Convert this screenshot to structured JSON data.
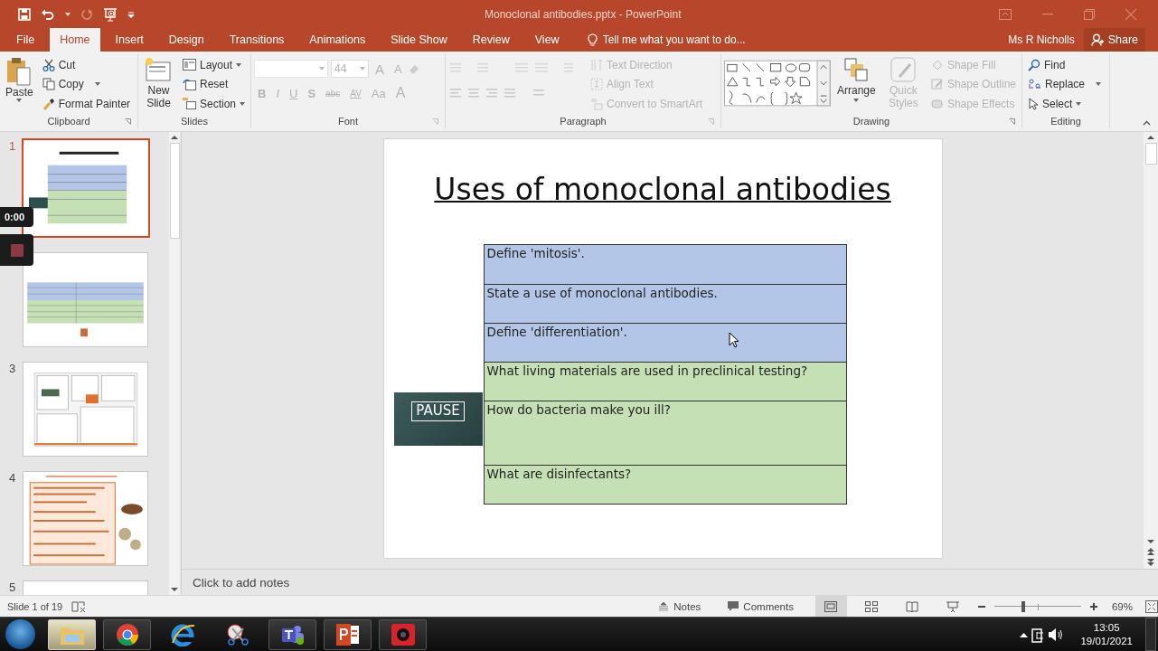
{
  "window": {
    "title": "Monoclonal antibodies.pptx - PowerPoint"
  },
  "tabs": [
    {
      "label": "File",
      "selected": false
    },
    {
      "label": "Home",
      "selected": true
    },
    {
      "label": "Insert",
      "selected": false
    },
    {
      "label": "Design",
      "selected": false
    },
    {
      "label": "Transitions",
      "selected": false
    },
    {
      "label": "Animations",
      "selected": false
    },
    {
      "label": "Slide Show",
      "selected": false
    },
    {
      "label": "Review",
      "selected": false
    },
    {
      "label": "View",
      "selected": false
    }
  ],
  "tell_me": {
    "placeholder": "Tell me what you want to do..."
  },
  "user": "Ms R Nicholls",
  "share": "Share",
  "clipboard": {
    "paste": "Paste",
    "cut": "Cut",
    "copy": "Copy",
    "format_painter": "Format Painter",
    "label": "Clipboard"
  },
  "slides_group": {
    "new_slide": "New Slide",
    "layout": "Layout",
    "reset": "Reset",
    "section": "Section",
    "label": "Slides"
  },
  "font": {
    "disabled": true,
    "size": "44",
    "size_buttons": [
      "A",
      "A"
    ],
    "format_buttons": [
      "B",
      "I",
      "U",
      "S",
      "abc",
      "AV",
      "Aa"
    ],
    "color_button": "A",
    "label": "Font"
  },
  "paragraph": {
    "disabled": true,
    "text_direction": "Text Direction",
    "align_text": "Align Text",
    "convert": "Convert to SmartArt",
    "label": "Paragraph"
  },
  "drawing": {
    "arrange": {
      "label": "Arrange",
      "disabled": false
    },
    "quick_styles": {
      "label": "Quick Styles",
      "disabled": true
    },
    "shape_fill": {
      "label": "Shape Fill",
      "disabled": true
    },
    "shape_outline": {
      "label": "Shape Outline",
      "disabled": true
    },
    "shape_effects": {
      "label": "Shape Effects",
      "disabled": true
    },
    "label": "Drawing"
  },
  "editing": {
    "find": "Find",
    "replace": "Replace",
    "select": "Select",
    "label": "Editing"
  },
  "thumbnails": [
    {
      "number": "1",
      "selected": true,
      "kind": "table"
    },
    {
      "selected": false,
      "kind": "answers"
    },
    {
      "number": "3",
      "selected": false,
      "kind": "poster"
    },
    {
      "number": "4",
      "selected": false,
      "kind": "notes"
    },
    {
      "number": "5",
      "selected": false,
      "kind": "blank"
    }
  ],
  "recorder": {
    "time": "0:00"
  },
  "slide": {
    "title": "Uses of monoclonal antibodies",
    "pause_sign": "PAUSE",
    "rows": [
      {
        "text": "Define 'mitosis'.",
        "color": "#b4c6e7"
      },
      {
        "text": "State a use of monoclonal antibodies.",
        "color": "#b4c6e7"
      },
      {
        "text": "Define 'differentiation'.",
        "color": "#b4c6e7"
      },
      {
        "text": "What living materials are used in preclinical testing?",
        "color": "#c5e0b4"
      },
      {
        "text": "How do bacteria make you ill?",
        "color": "#c5e0b4",
        "tall": true
      },
      {
        "text": "What are disinfectants?",
        "color": "#c5e0b4"
      }
    ]
  },
  "notes": {
    "placeholder": "Click to add notes"
  },
  "status": {
    "slide_counter": "Slide 1 of 19",
    "notes": "Notes",
    "comments": "Comments",
    "views": [
      {
        "selected": true
      },
      {
        "selected": false
      },
      {
        "selected": false
      },
      {
        "selected": false
      }
    ],
    "zoom": {
      "level": 0.33,
      "reading": "69%"
    }
  },
  "taskbar": {
    "apps": [
      {
        "kind": "explorer",
        "selected": true
      },
      {
        "kind": "chrome",
        "selected": false
      },
      {
        "kind": "ie",
        "selected": false
      },
      {
        "kind": "snip",
        "selected": false
      },
      {
        "kind": "teams",
        "selected": false
      },
      {
        "kind": "powerpoint",
        "selected": false
      },
      {
        "kind": "recorder",
        "selected": false
      }
    ],
    "time": "13:05",
    "date": "19/01/2021"
  }
}
